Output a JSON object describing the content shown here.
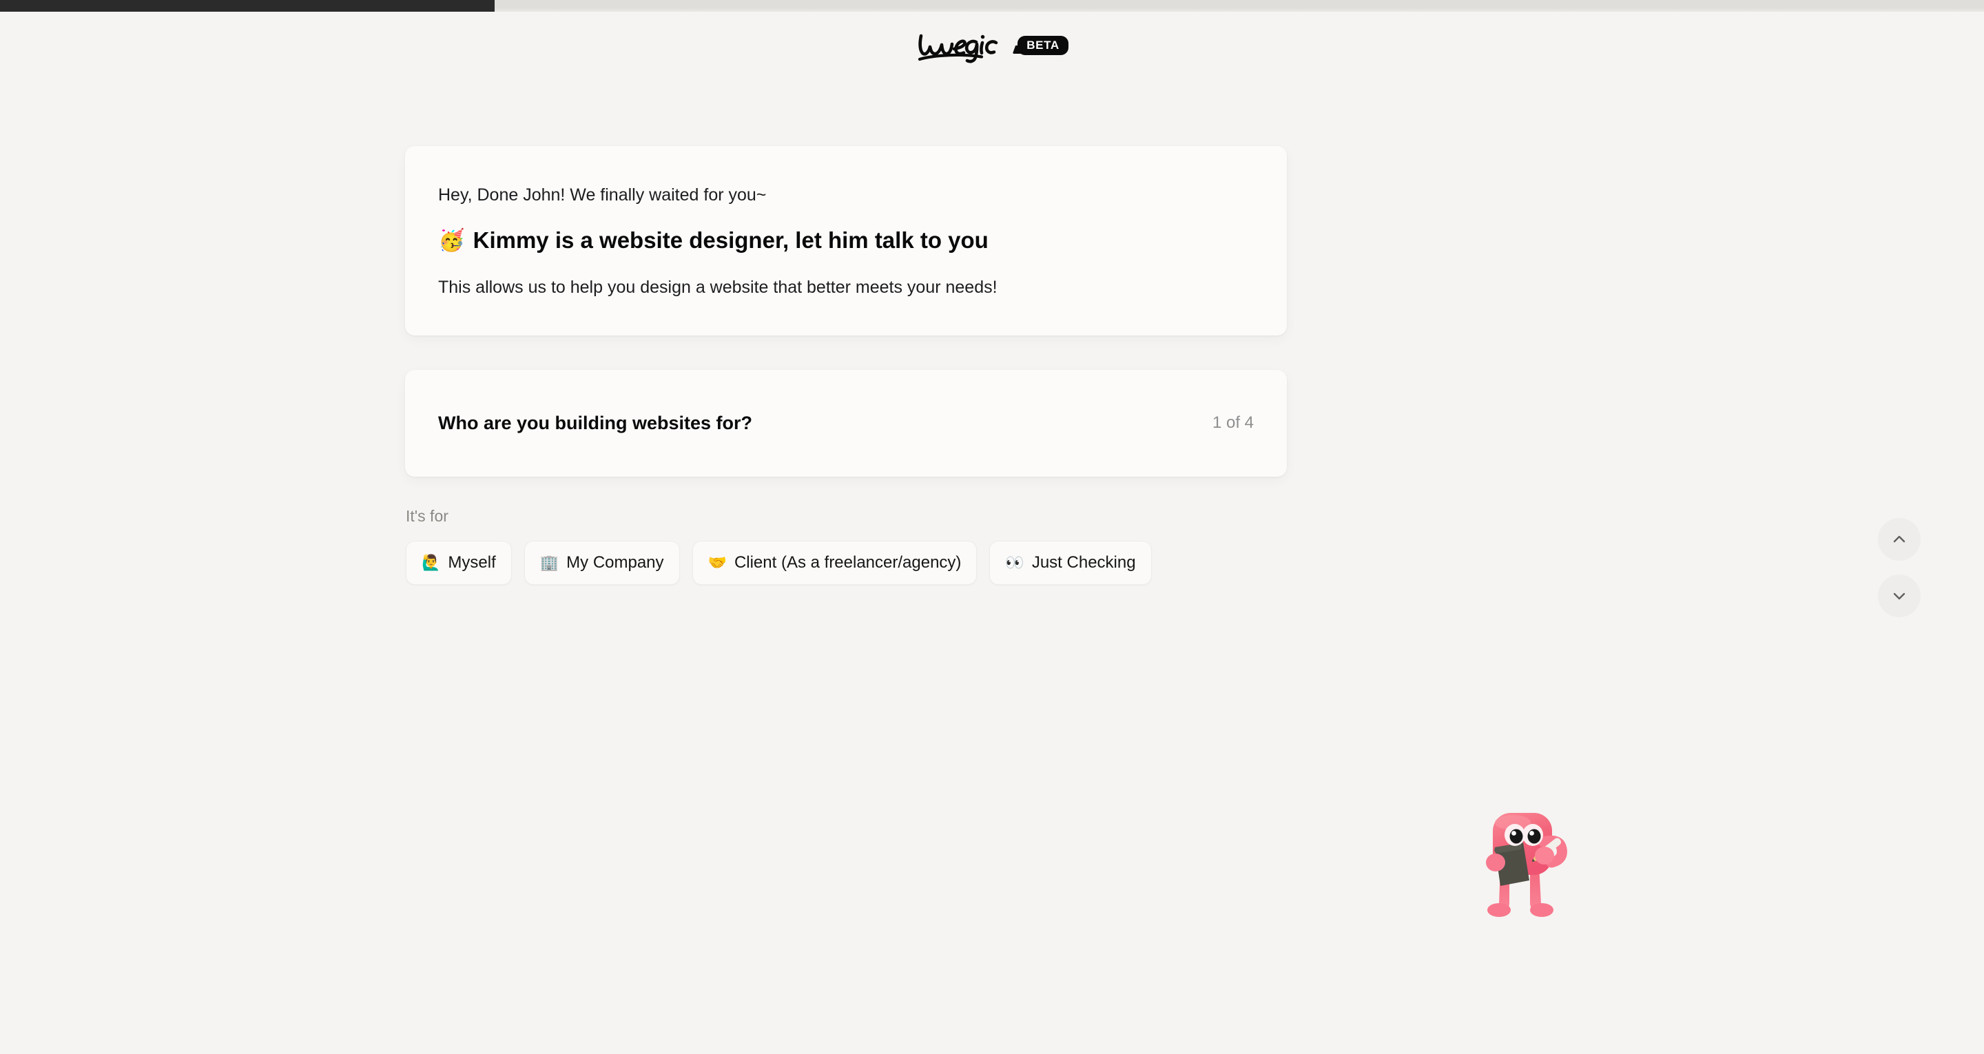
{
  "progress": {
    "percent": 25,
    "fill_color": "#2b2b2b",
    "track_color": "#dfdedb"
  },
  "brand": {
    "name": "wegic",
    "badge": "BETA"
  },
  "intro": {
    "greeting": "Hey, Done John! We finally waited for you~",
    "heading_emoji": "🥳",
    "heading": "Kimmy is a website designer, let him talk to you",
    "subtext": "This allows us to help you design a website that better meets your needs!"
  },
  "question": {
    "text": "Who are you building websites for?",
    "counter": "1 of 4"
  },
  "answers": {
    "label": "It's for",
    "options": [
      {
        "emoji": "🙋‍♂️",
        "label": "Myself"
      },
      {
        "emoji": "🏢",
        "label": "My Company"
      },
      {
        "emoji": "🤝",
        "label": "Client (As a freelancer/agency)"
      },
      {
        "emoji": "👀",
        "label": "Just Checking"
      }
    ]
  },
  "nav": {
    "up_icon": "chevron-up-icon",
    "down_icon": "chevron-down-icon"
  },
  "mascot": {
    "name": "wegic-mascot",
    "body_color": "#f2647a",
    "accent_color": "#f98ea0",
    "board_color": "#4a4a42"
  },
  "colors": {
    "page_background": "#f5f4f2",
    "card_background": "#fcfbfa",
    "text_primary": "#0a0a0a",
    "text_muted": "#8e8e8e"
  }
}
